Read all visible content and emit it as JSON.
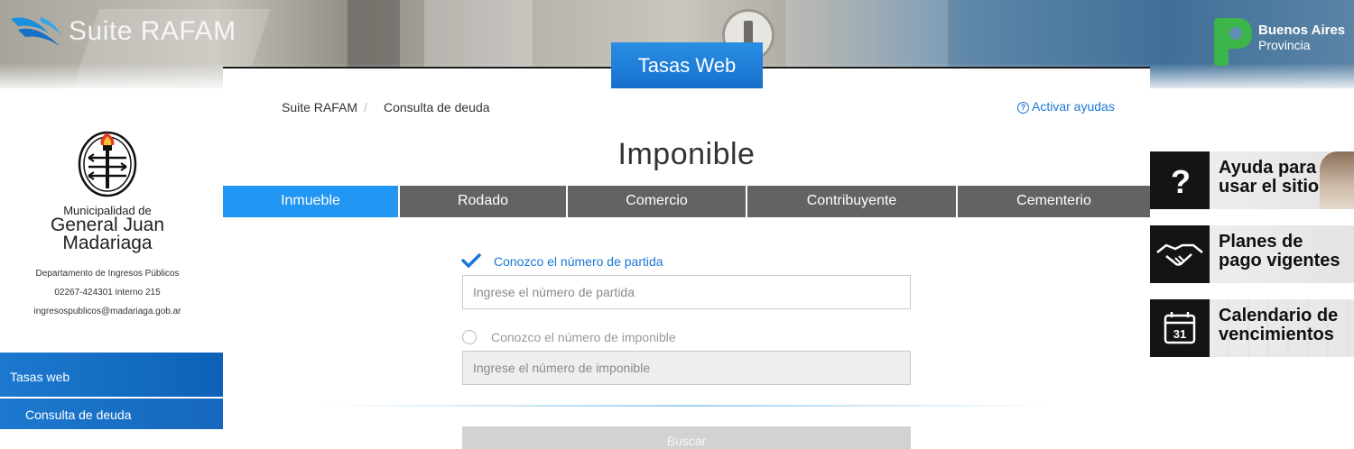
{
  "brand": {
    "suite_name": "Suite RAFAM",
    "province_title": "Buenos Aires",
    "province_sub": "Provincia"
  },
  "app_tag": "Tasas Web",
  "municipality": {
    "pre": "Municipalidad de",
    "name_line1": "General Juan",
    "name_line2": "Madariaga",
    "department": "Departamento de Ingresos Públicos",
    "phone": "02267-424301 interno 215",
    "email": "ingresospublicos@madariaga.gob.ar"
  },
  "sidebar": {
    "main_item": "Tasas web",
    "sub_item": "Consulta de deuda"
  },
  "breadcrumb": {
    "root": "Suite RAFAM",
    "separator": "/",
    "current": "Consulta de deuda"
  },
  "help_link": "Activar ayudas",
  "page_title": "Imponible",
  "tabs": [
    {
      "label": "Inmueble",
      "active": true
    },
    {
      "label": "Rodado",
      "active": false
    },
    {
      "label": "Comercio",
      "active": false
    },
    {
      "label": "Contribuyente",
      "active": false
    },
    {
      "label": "Cementerio",
      "active": false
    }
  ],
  "form": {
    "option1_label": "Conozco el número de partida",
    "option1_placeholder": "Ingrese el número de partida",
    "option1_selected": true,
    "option2_label": "Conozco el número de imponible",
    "option2_placeholder": "Ingrese el número de imponible",
    "option2_selected": false,
    "search_button": "Buscar"
  },
  "promos": [
    {
      "line1": "Ayuda para",
      "line2": "usar el sitio",
      "icon": "question-icon"
    },
    {
      "line1": "Planes de",
      "line2": "pago vigentes",
      "icon": "handshake-icon"
    },
    {
      "line1": "Calendario de",
      "line2": "vencimientos",
      "icon": "calendar-icon",
      "icon_text": "31"
    }
  ],
  "colors": {
    "accent": "#2196f3",
    "tab_inactive": "#636363",
    "link": "#1a78d4",
    "sidebar": "#1565c0"
  }
}
